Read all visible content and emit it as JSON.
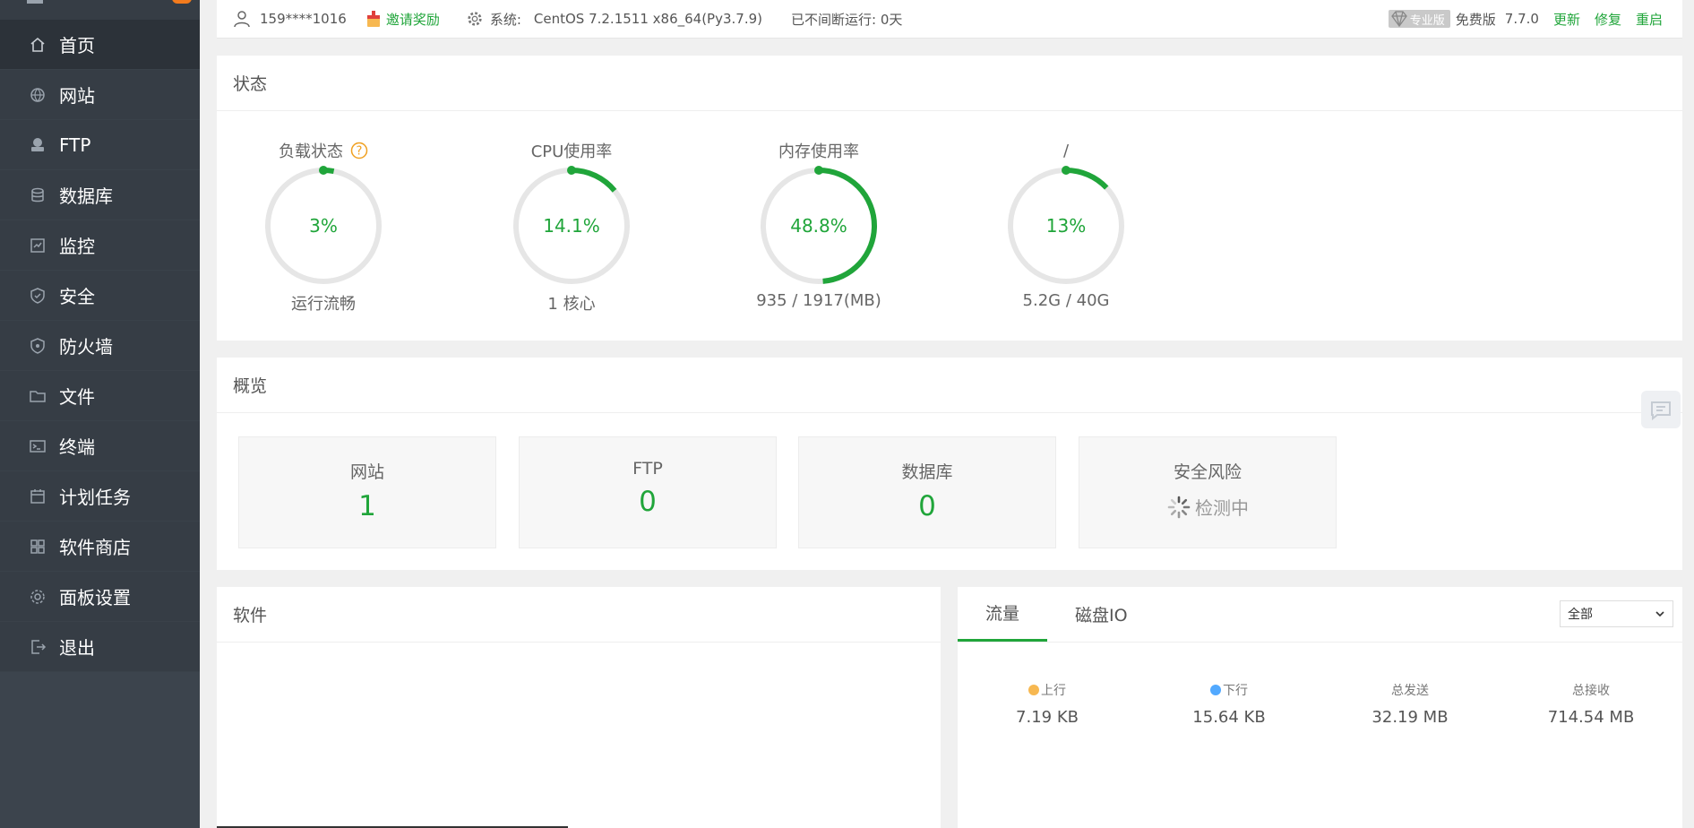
{
  "topbar": {
    "user": "159****1016",
    "invite": "邀请奖励",
    "system_label": "系统:",
    "system_value": "CentOS 7.2.1511 x86_64(Py3.7.9)",
    "uptime": "已不间断运行: 0天",
    "pro_label": "专业版",
    "free_label": "免费版",
    "version": "7.7.0",
    "update": "更新",
    "repair": "修复",
    "restart": "重启"
  },
  "sidebar": {
    "items": [
      {
        "label": "首页",
        "icon": "home-icon"
      },
      {
        "label": "网站",
        "icon": "globe-icon"
      },
      {
        "label": "FTP",
        "icon": "ftp-icon"
      },
      {
        "label": "数据库",
        "icon": "database-icon"
      },
      {
        "label": "监控",
        "icon": "monitor-icon"
      },
      {
        "label": "安全",
        "icon": "shield-icon"
      },
      {
        "label": "防火墙",
        "icon": "firewall-icon"
      },
      {
        "label": "文件",
        "icon": "folder-icon"
      },
      {
        "label": "终端",
        "icon": "terminal-icon"
      },
      {
        "label": "计划任务",
        "icon": "calendar-icon"
      },
      {
        "label": "软件商店",
        "icon": "apps-icon"
      },
      {
        "label": "面板设置",
        "icon": "gear-icon"
      },
      {
        "label": "退出",
        "icon": "logout-icon"
      }
    ]
  },
  "status": {
    "title": "状态",
    "gauges": [
      {
        "title": "负载状态",
        "value": "3%",
        "percent": 3,
        "sub": "运行流畅"
      },
      {
        "title": "CPU使用率",
        "value": "14.1%",
        "percent": 14.1,
        "sub": "1 核心"
      },
      {
        "title": "内存使用率",
        "value": "48.8%",
        "percent": 48.8,
        "sub": "935 / 1917(MB)"
      },
      {
        "title": "/",
        "value": "13%",
        "percent": 13,
        "sub": "5.2G / 40G"
      }
    ]
  },
  "overview": {
    "title": "概览",
    "cards": [
      {
        "label": "网站",
        "value": "1"
      },
      {
        "label": "FTP",
        "value": "0"
      },
      {
        "label": "数据库",
        "value": "0"
      },
      {
        "label": "安全风险",
        "value": "检测中"
      }
    ]
  },
  "software": {
    "title": "软件"
  },
  "traffic": {
    "tabs": [
      "流量",
      "磁盘IO"
    ],
    "select_value": "全部",
    "stats": [
      {
        "label": "上行",
        "value": "7.19 KB",
        "dot": "#f7b851"
      },
      {
        "label": "下行",
        "value": "15.64 KB",
        "dot": "#52a9ff"
      },
      {
        "label": "总发送",
        "value": "32.19 MB"
      },
      {
        "label": "总接收",
        "value": "714.54 MB"
      }
    ]
  },
  "colors": {
    "accent": "#20a53a",
    "sidebar": "#3c444d",
    "ring_track": "#e6e6e6"
  }
}
